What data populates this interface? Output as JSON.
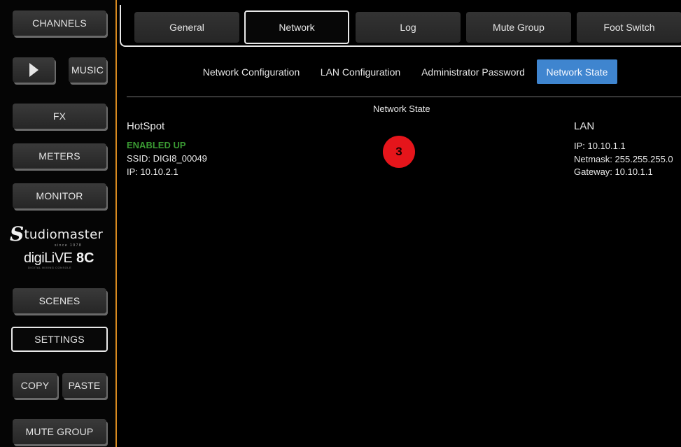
{
  "sidebar": {
    "channels": "CHANNELS",
    "music": "MUSIC",
    "fx": "FX",
    "meters": "METERS",
    "monitor": "MONITOR",
    "scenes": "SCENES",
    "settings": "SETTINGS",
    "copy": "COPY",
    "paste": "PASTE",
    "mute_group": "MUTE GROUP",
    "play_icon": "play-icon"
  },
  "logo": {
    "brand_initial": "S",
    "brand_rest": "tudiomaster",
    "since": "since 1978",
    "product_digi": "digiLiVE",
    "product_model": "8C",
    "tagline": "DIGITAL MIXING CONSOLE"
  },
  "tabs": {
    "general": "General",
    "network": "Network",
    "log": "Log",
    "mute_group": "Mute Group",
    "foot_switch": "Foot Switch"
  },
  "subtabs": {
    "network_configuration": "Network Configuration",
    "lan_configuration": "LAN Configuration",
    "administrator_password": "Administrator Password",
    "network_state": "Network State"
  },
  "content": {
    "heading": "Network State",
    "hotspot": {
      "title": "HotSpot",
      "status": "ENABLED UP",
      "ssid": "SSID: DIGI8_00049",
      "ip": "IP: 10.10.2.1"
    },
    "lan": {
      "title": "LAN",
      "ip": "IP: 10.10.1.1",
      "netmask": "Netmask: 255.255.255.0",
      "gateway": "Gateway: 10.10.1.1"
    },
    "badge": "3"
  },
  "colors": {
    "accent_orange": "#d98a1f",
    "active_subtab": "#3f85cf",
    "status_green": "#3a9a33",
    "badge_red": "#e5151b"
  }
}
